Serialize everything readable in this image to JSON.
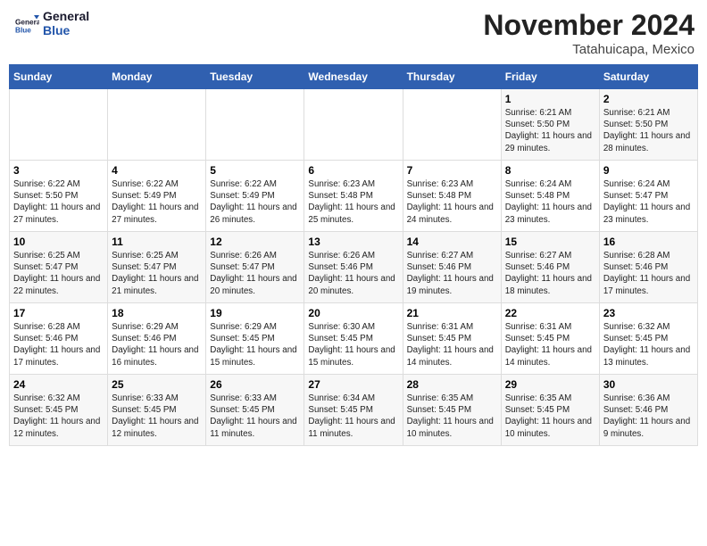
{
  "logo": {
    "line1": "General",
    "line2": "Blue"
  },
  "title": "November 2024",
  "subtitle": "Tatahuicapa, Mexico",
  "weekdays": [
    "Sunday",
    "Monday",
    "Tuesday",
    "Wednesday",
    "Thursday",
    "Friday",
    "Saturday"
  ],
  "weeks": [
    [
      {
        "day": "",
        "info": ""
      },
      {
        "day": "",
        "info": ""
      },
      {
        "day": "",
        "info": ""
      },
      {
        "day": "",
        "info": ""
      },
      {
        "day": "",
        "info": ""
      },
      {
        "day": "1",
        "info": "Sunrise: 6:21 AM\nSunset: 5:50 PM\nDaylight: 11 hours and 29 minutes."
      },
      {
        "day": "2",
        "info": "Sunrise: 6:21 AM\nSunset: 5:50 PM\nDaylight: 11 hours and 28 minutes."
      }
    ],
    [
      {
        "day": "3",
        "info": "Sunrise: 6:22 AM\nSunset: 5:50 PM\nDaylight: 11 hours and 27 minutes."
      },
      {
        "day": "4",
        "info": "Sunrise: 6:22 AM\nSunset: 5:49 PM\nDaylight: 11 hours and 27 minutes."
      },
      {
        "day": "5",
        "info": "Sunrise: 6:22 AM\nSunset: 5:49 PM\nDaylight: 11 hours and 26 minutes."
      },
      {
        "day": "6",
        "info": "Sunrise: 6:23 AM\nSunset: 5:48 PM\nDaylight: 11 hours and 25 minutes."
      },
      {
        "day": "7",
        "info": "Sunrise: 6:23 AM\nSunset: 5:48 PM\nDaylight: 11 hours and 24 minutes."
      },
      {
        "day": "8",
        "info": "Sunrise: 6:24 AM\nSunset: 5:48 PM\nDaylight: 11 hours and 23 minutes."
      },
      {
        "day": "9",
        "info": "Sunrise: 6:24 AM\nSunset: 5:47 PM\nDaylight: 11 hours and 23 minutes."
      }
    ],
    [
      {
        "day": "10",
        "info": "Sunrise: 6:25 AM\nSunset: 5:47 PM\nDaylight: 11 hours and 22 minutes."
      },
      {
        "day": "11",
        "info": "Sunrise: 6:25 AM\nSunset: 5:47 PM\nDaylight: 11 hours and 21 minutes."
      },
      {
        "day": "12",
        "info": "Sunrise: 6:26 AM\nSunset: 5:47 PM\nDaylight: 11 hours and 20 minutes."
      },
      {
        "day": "13",
        "info": "Sunrise: 6:26 AM\nSunset: 5:46 PM\nDaylight: 11 hours and 20 minutes."
      },
      {
        "day": "14",
        "info": "Sunrise: 6:27 AM\nSunset: 5:46 PM\nDaylight: 11 hours and 19 minutes."
      },
      {
        "day": "15",
        "info": "Sunrise: 6:27 AM\nSunset: 5:46 PM\nDaylight: 11 hours and 18 minutes."
      },
      {
        "day": "16",
        "info": "Sunrise: 6:28 AM\nSunset: 5:46 PM\nDaylight: 11 hours and 17 minutes."
      }
    ],
    [
      {
        "day": "17",
        "info": "Sunrise: 6:28 AM\nSunset: 5:46 PM\nDaylight: 11 hours and 17 minutes."
      },
      {
        "day": "18",
        "info": "Sunrise: 6:29 AM\nSunset: 5:46 PM\nDaylight: 11 hours and 16 minutes."
      },
      {
        "day": "19",
        "info": "Sunrise: 6:29 AM\nSunset: 5:45 PM\nDaylight: 11 hours and 15 minutes."
      },
      {
        "day": "20",
        "info": "Sunrise: 6:30 AM\nSunset: 5:45 PM\nDaylight: 11 hours and 15 minutes."
      },
      {
        "day": "21",
        "info": "Sunrise: 6:31 AM\nSunset: 5:45 PM\nDaylight: 11 hours and 14 minutes."
      },
      {
        "day": "22",
        "info": "Sunrise: 6:31 AM\nSunset: 5:45 PM\nDaylight: 11 hours and 14 minutes."
      },
      {
        "day": "23",
        "info": "Sunrise: 6:32 AM\nSunset: 5:45 PM\nDaylight: 11 hours and 13 minutes."
      }
    ],
    [
      {
        "day": "24",
        "info": "Sunrise: 6:32 AM\nSunset: 5:45 PM\nDaylight: 11 hours and 12 minutes."
      },
      {
        "day": "25",
        "info": "Sunrise: 6:33 AM\nSunset: 5:45 PM\nDaylight: 11 hours and 12 minutes."
      },
      {
        "day": "26",
        "info": "Sunrise: 6:33 AM\nSunset: 5:45 PM\nDaylight: 11 hours and 11 minutes."
      },
      {
        "day": "27",
        "info": "Sunrise: 6:34 AM\nSunset: 5:45 PM\nDaylight: 11 hours and 11 minutes."
      },
      {
        "day": "28",
        "info": "Sunrise: 6:35 AM\nSunset: 5:45 PM\nDaylight: 11 hours and 10 minutes."
      },
      {
        "day": "29",
        "info": "Sunrise: 6:35 AM\nSunset: 5:45 PM\nDaylight: 11 hours and 10 minutes."
      },
      {
        "day": "30",
        "info": "Sunrise: 6:36 AM\nSunset: 5:46 PM\nDaylight: 11 hours and 9 minutes."
      }
    ]
  ]
}
